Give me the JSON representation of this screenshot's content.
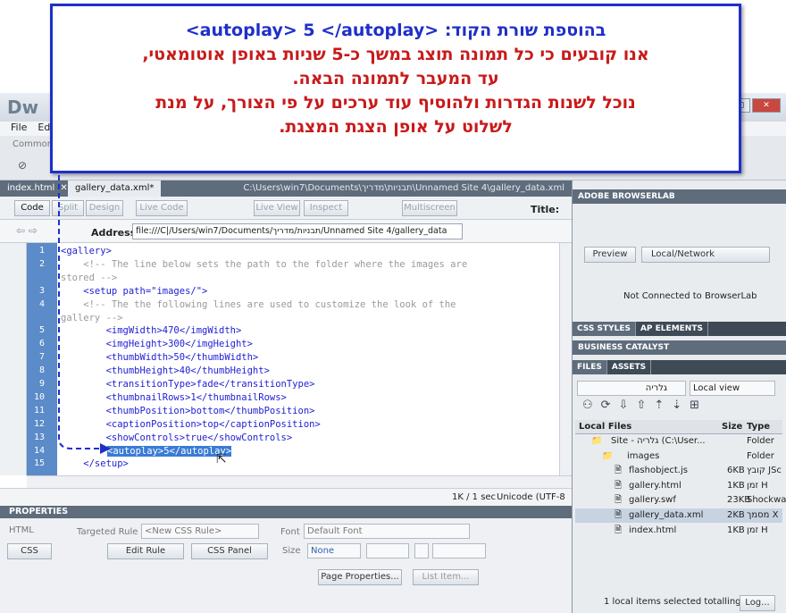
{
  "app": {
    "logo": "Dw",
    "menu": [
      "File",
      "Edi"
    ],
    "insert_tab": "Common"
  },
  "tabs": [
    {
      "label": "index.html"
    },
    {
      "label": "gallery_data.xml*"
    }
  ],
  "doc_path": "C:\\Users\\win7\\Documents\\תבניות\\מדריך\\Unnamed Site 4\\gallery_data.xml",
  "toolbar": {
    "code": "Code",
    "split": "Split",
    "design": "Design",
    "live_code": "Live Code",
    "live_view": "Live View",
    "inspect": "Inspect",
    "multiscreen": "Multiscreen",
    "title_label": "Title:"
  },
  "address": {
    "label": "Address:",
    "value": "file:///C|/Users/win7/Documents/תבניות/מדריך/Unnamed Site 4/gallery_data"
  },
  "line_numbers": [
    "1",
    "2",
    "",
    "3",
    "4",
    "",
    "5",
    "6",
    "7",
    "8",
    "9",
    "10",
    "11",
    "12",
    "13",
    "14",
    "15"
  ],
  "code_lines": [
    "<gallery>",
    "    <!-- The line below sets the path to the folder where the images are",
    "stored -->",
    "    <setup path=\"images/\">",
    "    <!-- The the following lines are used to customize the look of the",
    "gallery -->",
    "        <imgWidth>470</imgWidth>",
    "        <imgHeight>300</imgHeight>",
    "        <thumbWidth>50</thumbWidth>",
    "        <thumbHeight>40</thumbHeight>",
    "        <transitionType>fade</transitionType>",
    "        <thumbnailRows>1</thumbnailRows>",
    "        <thumbPosition>bottom</thumbPosition>",
    "        <captionPosition>top</captionPosition>",
    "        <showControls>true</showControls>",
    "<autoplay>5</autoplay>",
    "    </setup>"
  ],
  "status": {
    "size": "1K / 1 sec",
    "encoding": "Unicode (UTF-8"
  },
  "properties": {
    "header": "PROPERTIES",
    "html": "HTML",
    "css": "CSS",
    "targeted_rule_label": "Targeted Rule",
    "targeted_rule_value": "<New CSS Rule>",
    "edit_rule": "Edit Rule",
    "css_panel": "CSS Panel",
    "font_label": "Font",
    "font_value": "Default Font",
    "size_label": "Size",
    "size_value": "None",
    "page_properties": "Page Properties...",
    "list_item": "List Item..."
  },
  "browserlab": {
    "header": "ADOBE BROWSERLAB",
    "preview": "Preview",
    "location": "Local/Network",
    "status": "Not Connected to BrowserLab"
  },
  "panel_tabs": {
    "css_styles": "CSS STYLES",
    "ap_elements": "AP ELEMENTS",
    "business_catalyst": "BUSINESS CATALYST",
    "files": "FILES",
    "assets": "ASSETS"
  },
  "files": {
    "site": "גלריה",
    "view": "Local view",
    "col_local": "Local Files",
    "col_size": "Size",
    "col_type": "Type",
    "rows": [
      {
        "name": "Site - גלריה (C:\\User...",
        "size": "",
        "type": "Folder"
      },
      {
        "name": "images",
        "size": "",
        "type": "Folder"
      },
      {
        "name": "flashobject.js",
        "size": "6KB",
        "type": "קובץ JSc"
      },
      {
        "name": "gallery.html",
        "size": "1KB",
        "type": "זמן H"
      },
      {
        "name": "gallery.swf",
        "size": "23KB",
        "type": "Shockwa"
      },
      {
        "name": "gallery_data.xml",
        "size": "2KB",
        "type": "מסמך X"
      },
      {
        "name": "index.html",
        "size": "1KB",
        "type": "זמן H"
      }
    ],
    "status": "1 local items selected totalling",
    "log": "Log..."
  },
  "callout": {
    "line1": "בהוספת שורת הקוד: <autoplay> 5 </autoplay>",
    "line2": "אנו קובעים כי כל תמונה תוצג במשך כ-5 שניות באופן אוטומאטי,",
    "line3": "עד המעבר לתמונה הבאה.",
    "line4": "נוכל לשנות הגדרות ולהוסיף עוד ערכים על פי הצורך, על מנת",
    "line5": "לשלוט על אופן הצגת המצגת."
  },
  "colors": {
    "callout_border": "#1f2fc9",
    "callout_text": "#c81a1a",
    "gutter": "#5b8bc8",
    "highlight": "#3a7bd5"
  }
}
